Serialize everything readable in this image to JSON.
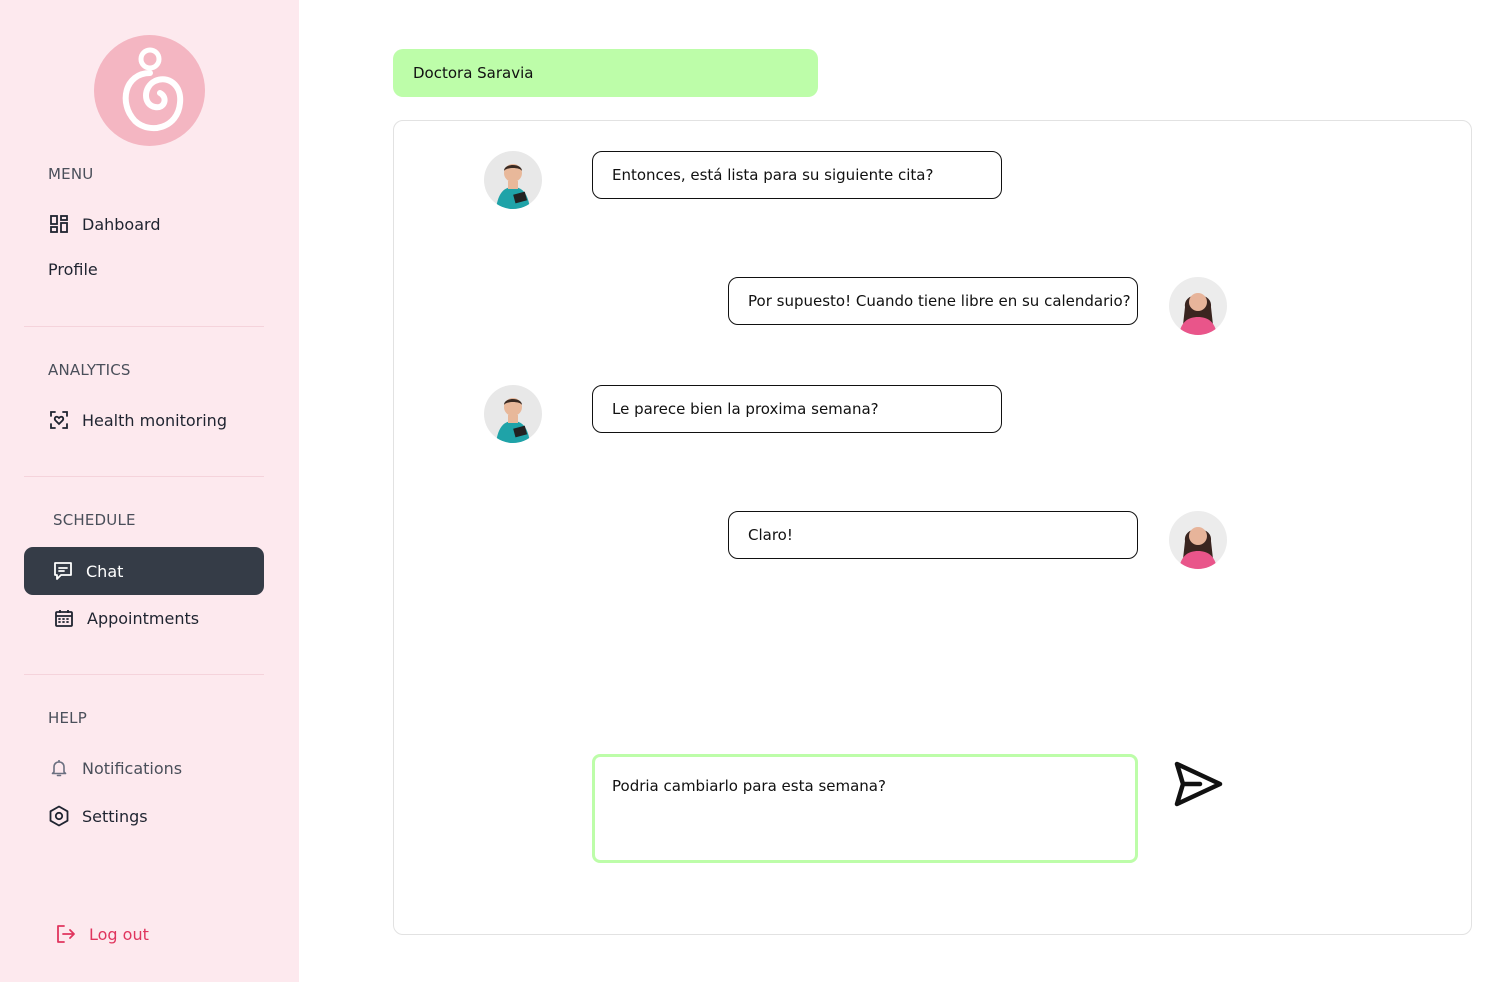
{
  "sidebar": {
    "menu_label": "MENU",
    "menu_items": [
      {
        "label": "Dahboard",
        "icon": "dashboard-icon"
      },
      {
        "label": "Profile"
      }
    ],
    "analytics_label": "ANALYTICS",
    "analytics_items": [
      {
        "label": "Health monitoring",
        "icon": "heart-scan-icon"
      }
    ],
    "schedule_label": "SCHEDULE",
    "schedule_items": [
      {
        "label": "Chat",
        "icon": "chat-icon",
        "active": true
      },
      {
        "label": "Appointments",
        "icon": "calendar-icon"
      }
    ],
    "help_label": "HELP",
    "help_items": [
      {
        "label": "Notifications",
        "icon": "bell-icon"
      },
      {
        "label": "Settings",
        "icon": "settings-icon"
      }
    ],
    "logout_label": "Log out"
  },
  "chat": {
    "contact_name": "Doctora Saravia",
    "messages": [
      {
        "from": "doctor",
        "text": "Entonces, está lista para su siguiente cita?"
      },
      {
        "from": "patient",
        "text": "Por supuesto! Cuando tiene libre en su calendario?"
      },
      {
        "from": "doctor",
        "text": "Le parece bien la proxima semana?"
      },
      {
        "from": "patient",
        "text": "Claro!"
      }
    ],
    "composer_value": "Podria cambiarlo para esta semana?"
  },
  "colors": {
    "sidebar_bg": "#fde9ee",
    "logo": "#f4b6c2",
    "active_nav": "#353c47",
    "accent_green": "#bdfda9",
    "logout": "#e0355e"
  }
}
